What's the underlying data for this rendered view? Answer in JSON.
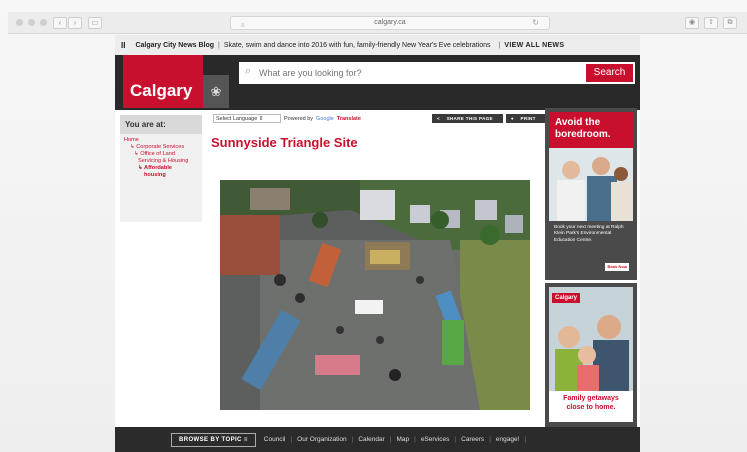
{
  "browser": {
    "url": "calgary.ca"
  },
  "newsbar": {
    "pause_icon": "pause-icon",
    "blog": "Calgary City News Blog",
    "separator": "|",
    "headline": "Skate, swim and dance into 2016 with fun, family-friendly New Year's Eve celebrations",
    "view_all": "VIEW ALL NEWS"
  },
  "header": {
    "logo": "Calgary",
    "search_placeholder": "What are you looking for?",
    "search_button": "Search"
  },
  "sidebar": {
    "you_are_at": "You are at:",
    "breadcrumbs": [
      "Home",
      "↳ Corporate Services",
      "↳ Office of Land",
      "Servicing & Housing",
      "↳ Affordable",
      "housing"
    ]
  },
  "toolbar": {
    "language": "Select Language",
    "powered_by": "Powered by",
    "google": "Google",
    "translate": "Translate",
    "share": "SHARE THIS PAGE",
    "print": "PRINT"
  },
  "main": {
    "title": "Sunnyside Triangle Site"
  },
  "ad1": {
    "heading_line1": "Avoid the",
    "heading_line2": "boredroom.",
    "body": "Book your next meeting at Ralph Klein Park's Environmental Education Centre.",
    "button": "Book Now"
  },
  "ad2": {
    "logo": "Calgary",
    "caption_line1": "Family getaways",
    "caption_line2": "close to home."
  },
  "footer": {
    "browse": "BROWSE BY TOPIC",
    "links": [
      "Council",
      "Our Organization",
      "Calendar",
      "Map",
      "eServices",
      "Careers",
      "engage!"
    ]
  },
  "colors": {
    "brand_red": "#c8102e",
    "dark_bar": "#292929"
  }
}
